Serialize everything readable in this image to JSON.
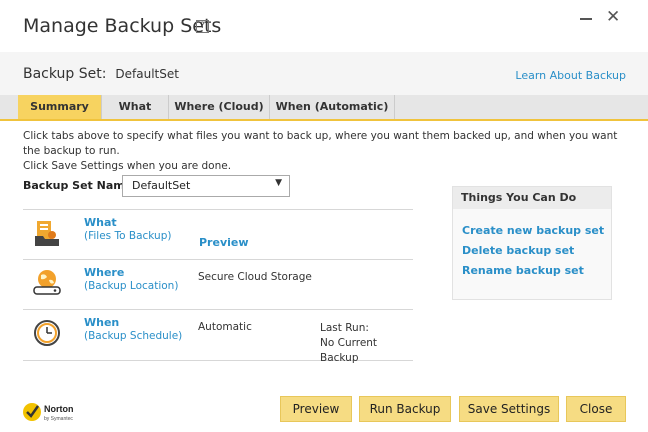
{
  "window": {
    "title": "Manage Backup Sets",
    "help_label": "?",
    "close_label": "✕"
  },
  "set": {
    "label_prefix": "Backup Set:",
    "name": "DefaultSet",
    "learn_link": "Learn About Backup"
  },
  "tabs": [
    {
      "label": "Summary",
      "active": true
    },
    {
      "label": "What"
    },
    {
      "label": "Where (Cloud)"
    },
    {
      "label": "When (Automatic)"
    }
  ],
  "instructions": {
    "line1": "Click tabs above to specify what files you want to back up, where you want them backed up, and when you want the backup to run.",
    "line2": "Click Save Settings when you are done."
  },
  "backup_set_name": {
    "label": "Backup Set Name:",
    "value": "DefaultSet"
  },
  "rows": {
    "what": {
      "title": "What",
      "subtitle": "(Files To Backup)",
      "link": "Preview"
    },
    "where": {
      "title": "Where",
      "subtitle": "(Backup Location)",
      "value": "Secure Cloud Storage"
    },
    "when": {
      "title": "When",
      "subtitle": "(Backup Schedule)",
      "value": "Automatic",
      "last_run_label": "Last Run:",
      "last_run_value": "No Current Backup"
    }
  },
  "panel": {
    "title": "Things You Can Do",
    "links": [
      "Create new backup set",
      "Delete backup set",
      "Rename backup set"
    ]
  },
  "buttons": {
    "preview": "Preview",
    "run": "Run Backup",
    "save": "Save Settings",
    "close": "Close"
  },
  "brand": {
    "name": "Norton",
    "sub": "by Symantec"
  },
  "colors": {
    "accent": "#f7d360",
    "link": "#2a8fc8",
    "button": "#f6dc83"
  }
}
